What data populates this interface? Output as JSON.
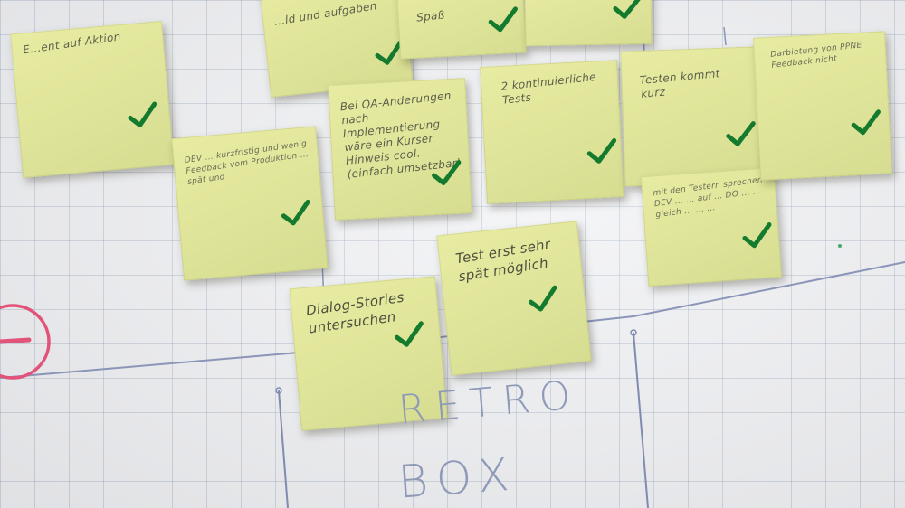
{
  "board": {
    "title_line1": "RETRO",
    "title_line2": "BOX"
  },
  "notes": [
    {
      "id": "n1",
      "text": "E...ent auf Aktion"
    },
    {
      "id": "n2",
      "text": "...ld und aufgaben"
    },
    {
      "id": "n3",
      "text": "Spaß"
    },
    {
      "id": "n4",
      "text": ""
    },
    {
      "id": "n5",
      "text": "DEV ... kurzfristig und wenig Feedback vom Produktion ... spät und"
    },
    {
      "id": "n6",
      "text": "Bei QA-Anderungen nach Implementierung wäre ein Kurser Hinweis cool. (einfach umsetzbar)"
    },
    {
      "id": "n7",
      "text": "2 kontinuierliche Tests"
    },
    {
      "id": "n8",
      "text": "Testen kommt kurz"
    },
    {
      "id": "n9",
      "text": "mit den Testern sprechen  DEV ... ... auf ... DO ... ... gleich ... ... ..."
    },
    {
      "id": "n10",
      "text": "Darbietung von PPNE Feedback nicht"
    },
    {
      "id": "n11",
      "text": "Dialog-Stories untersuchen"
    },
    {
      "id": "n12",
      "text": "Test erst sehr spät möglich"
    }
  ]
}
